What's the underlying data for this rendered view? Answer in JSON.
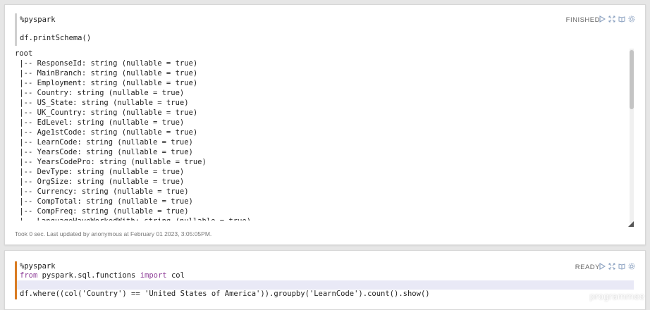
{
  "paragraph1": {
    "code_lines": [
      "%pyspark",
      "",
      "df.printSchema()"
    ],
    "status": "FINISHED",
    "output_lines": [
      "root",
      " |-- ResponseId: string (nullable = true)",
      " |-- MainBranch: string (nullable = true)",
      " |-- Employment: string (nullable = true)",
      " |-- Country: string (nullable = true)",
      " |-- US_State: string (nullable = true)",
      " |-- UK_Country: string (nullable = true)",
      " |-- EdLevel: string (nullable = true)",
      " |-- Age1stCode: string (nullable = true)",
      " |-- LearnCode: string (nullable = true)",
      " |-- YearsCode: string (nullable = true)",
      " |-- YearsCodePro: string (nullable = true)",
      " |-- DevType: string (nullable = true)",
      " |-- OrgSize: string (nullable = true)",
      " |-- Currency: string (nullable = true)",
      " |-- CompTotal: string (nullable = true)",
      " |-- CompFreq: string (nullable = true)",
      " |-- LanguageHaveWorkedWith: string (nullable = true)"
    ],
    "footer": "Took 0 sec. Last updated by anonymous at February 01 2023, 3:05:05PM."
  },
  "paragraph2": {
    "line1": "%pyspark",
    "line2_kw1": "from",
    "line2_mod": " pyspark.sql.functions ",
    "line2_kw2": "import",
    "line2_name": " col",
    "line3": "",
    "line4": "df.where((col('Country') == 'United States of America')).groupby('LearnCode').count().show()",
    "status": "READY"
  },
  "controls": [
    "run-icon",
    "expand-icon",
    "book-icon",
    "gear-icon"
  ],
  "watermark": "programmee",
  "colors": {
    "background": "#e6e6e6",
    "active_border": "#d97b22",
    "keyword": "#8f3f99"
  }
}
